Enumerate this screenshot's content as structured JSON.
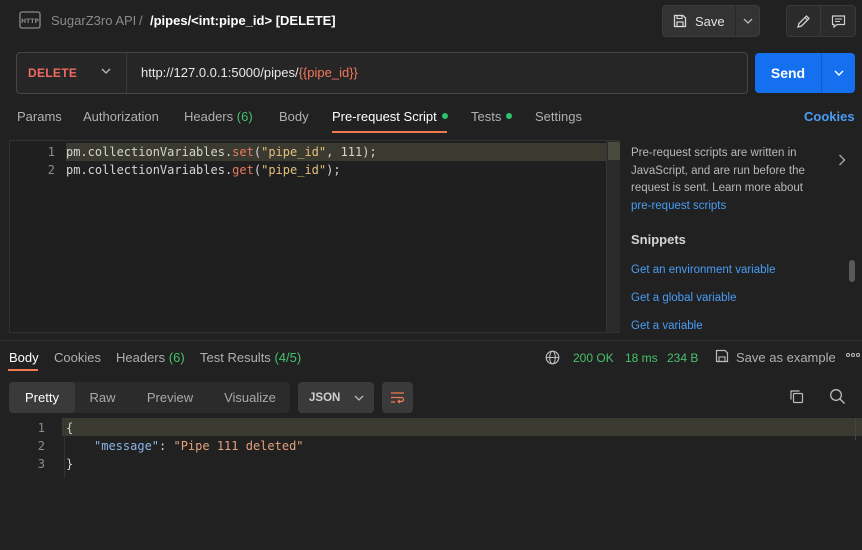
{
  "header": {
    "http_icon": "http-file-icon",
    "collection": "SugarZ3ro API",
    "separator": "/",
    "request_title": "/pipes/<int:pipe_id> [DELETE]",
    "save_label": "Save",
    "save_icon": "floppy-icon",
    "edit_icon": "pencil-icon",
    "comment_icon": "comment-icon"
  },
  "urlbar": {
    "method": "DELETE",
    "url_base": "http://127.0.0.1:5000/pipes/",
    "url_var": "{{pipe_id}}",
    "send_label": "Send"
  },
  "request_tabs": [
    {
      "label": "Params"
    },
    {
      "label": "Authorization"
    },
    {
      "label": "Headers",
      "count": "(6)"
    },
    {
      "label": "Body"
    },
    {
      "label": "Pre-request Script",
      "dot": true,
      "active": true
    },
    {
      "label": "Tests",
      "dot": true
    },
    {
      "label": "Settings"
    }
  ],
  "cookies_label": "Cookies",
  "script_editor": {
    "lines": [
      {
        "n": "1",
        "obj": "pm.collectionVariables.",
        "fn": "set",
        "open": "(",
        "str": "\"pipe_id\"",
        "rest": ", 111);"
      },
      {
        "n": "2",
        "obj": "pm.collectionVariables.",
        "fn": "get",
        "open": "(",
        "str": "\"pipe_id\"",
        "rest": ");"
      }
    ]
  },
  "side_panel": {
    "description": "Pre-request scripts are written in JavaScript, and are run before the request is sent. Learn more about",
    "learn_link": "pre-request scripts",
    "snippets_heading": "Snippets",
    "snippets": [
      "Get an environment variable",
      "Get a global variable",
      "Get a variable"
    ]
  },
  "response_tabs": [
    {
      "label": "Body",
      "active": true
    },
    {
      "label": "Cookies"
    },
    {
      "label": "Headers",
      "count": "(6)"
    },
    {
      "label": "Test Results",
      "count": "(4/5)"
    }
  ],
  "response_meta": {
    "status": "200 OK",
    "time": "18 ms",
    "size": "234 B",
    "save_example": "Save as example",
    "more": "ooo"
  },
  "view_modes": [
    "Pretty",
    "Raw",
    "Preview",
    "Visualize"
  ],
  "format": "JSON",
  "response_body": {
    "lines": [
      {
        "n": "1",
        "text": "{"
      },
      {
        "n": "2",
        "key": "\"message\"",
        "colon": ": ",
        "value": "\"Pipe 111 deleted\""
      },
      {
        "n": "3",
        "text": "}"
      }
    ]
  },
  "colors": {
    "accent": "#1570ef",
    "method_delete": "#f16a62",
    "active_tab_underline": "#f07a4f",
    "status_green": "#45c26b",
    "link_blue": "#4a9cf5"
  }
}
